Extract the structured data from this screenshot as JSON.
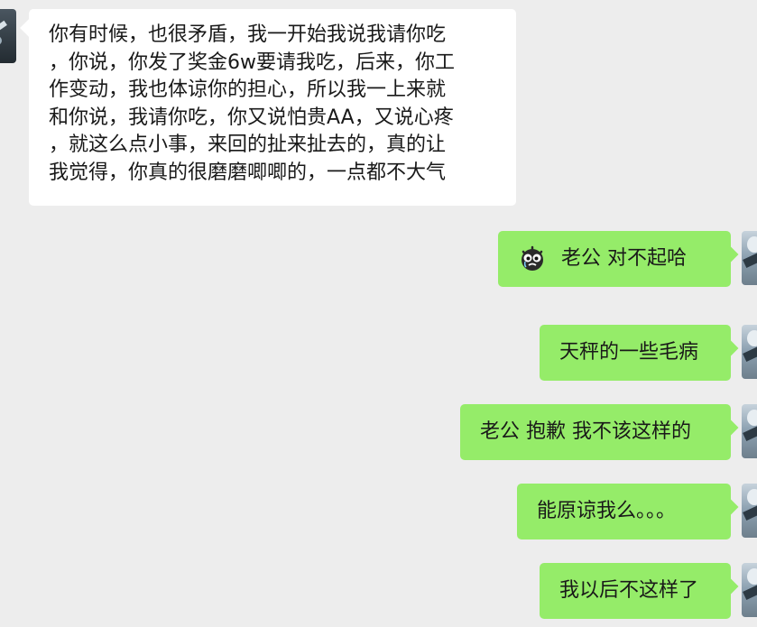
{
  "incoming": {
    "lines": [
      "你有时候，也很矛盾，我一开始我说我请你吃",
      "，你说，你发了奖金6w要请我吃，后来，你工",
      "作变动，我也体谅你的担心，所以我一上来就",
      "和你说，我请你吃，你又说怕贵AA，又说心疼",
      "，就这么点小事，来回的扯来扯去的，真的让",
      "我觉得，你真的很磨磨唧唧的，一点都不大气"
    ]
  },
  "outgoing": [
    {
      "text": "老公 对不起哈",
      "icon": "crying-face-emoji"
    },
    {
      "text": "天秤的一些毛病"
    },
    {
      "text": "老公 抱歉 我不该这样的"
    },
    {
      "text": "能原谅我么。。。"
    },
    {
      "text": "我以后不这样了"
    }
  ],
  "colors": {
    "background": "#ededed",
    "incoming_bubble": "#ffffff",
    "outgoing_bubble": "#95ec69"
  }
}
